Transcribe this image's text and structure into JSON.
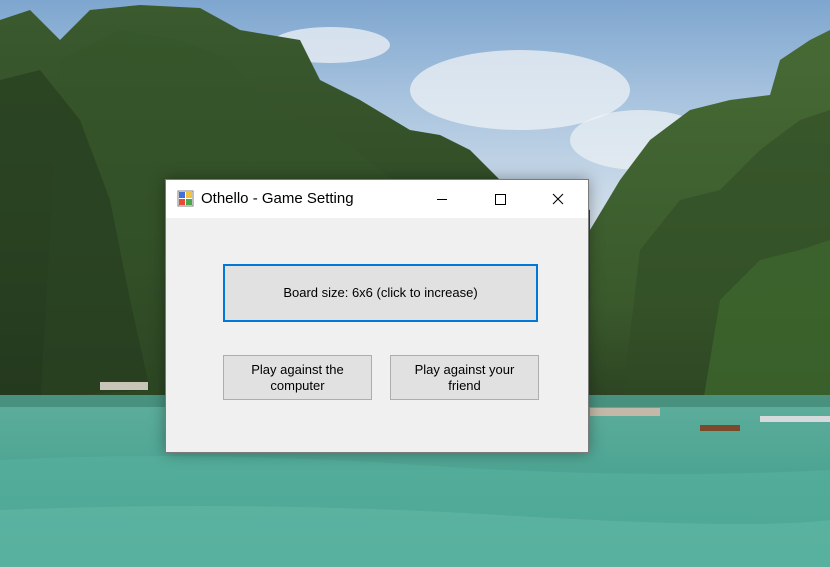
{
  "window": {
    "title": "Othello - Game Setting",
    "icon": "othello-app-icon",
    "controls": {
      "minimize_icon": "minimize-icon",
      "maximize_icon": "maximize-icon",
      "close_icon": "close-icon"
    }
  },
  "buttons": {
    "board_size": "Board size: 6x6 (click to increase)",
    "vs_computer": "Play against the computer",
    "vs_friend": "Play against your friend"
  },
  "colors": {
    "focus_border": "#0078d7",
    "dialog_background": "#f0f0f0",
    "button_background": "#e1e1e1"
  }
}
